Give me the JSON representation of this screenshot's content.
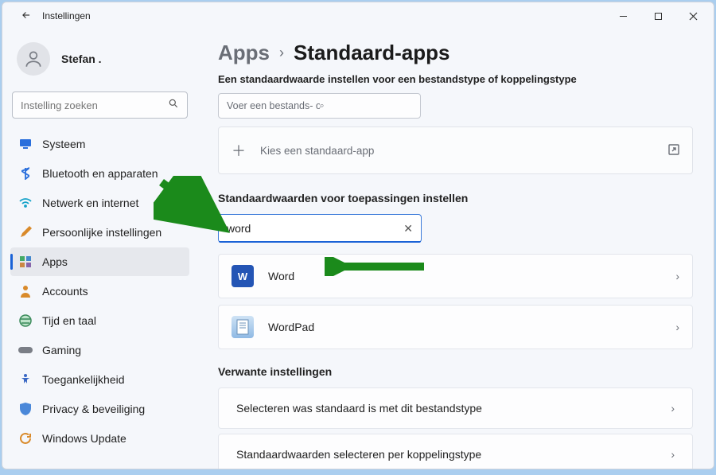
{
  "window": {
    "title": "Instellingen"
  },
  "user": {
    "name": "Stefan ."
  },
  "sidebar_search": {
    "placeholder": "Instelling zoeken"
  },
  "nav": {
    "items": [
      {
        "label": "Systeem"
      },
      {
        "label": "Bluetooth en apparaten"
      },
      {
        "label": "Netwerk en internet"
      },
      {
        "label": "Persoonlijke instellingen"
      },
      {
        "label": "Apps"
      },
      {
        "label": "Accounts"
      },
      {
        "label": "Tijd en taal"
      },
      {
        "label": "Gaming"
      },
      {
        "label": "Toegankelijkheid"
      },
      {
        "label": "Privacy & beveiliging"
      },
      {
        "label": "Windows Update"
      }
    ]
  },
  "breadcrumb": {
    "root": "Apps",
    "current": "Standaard-apps"
  },
  "subtitle": "Een standaardwaarde instellen voor een bestandstype of koppelingstype",
  "type_input": {
    "placeholder": "Voer een bestands- of koppelingstype in"
  },
  "choose_panel": {
    "label": "Kies een standaard-app"
  },
  "section_apps": {
    "title": "Standaardwaarden voor toepassingen instellen",
    "search_value": "word",
    "results": [
      {
        "name": "Word"
      },
      {
        "name": "WordPad"
      }
    ]
  },
  "related": {
    "title": "Verwante instellingen",
    "items": [
      {
        "label": "Selecteren was standaard is met dit bestandstype"
      },
      {
        "label": "Standaardwaarden selecteren per koppelingstype"
      }
    ]
  }
}
